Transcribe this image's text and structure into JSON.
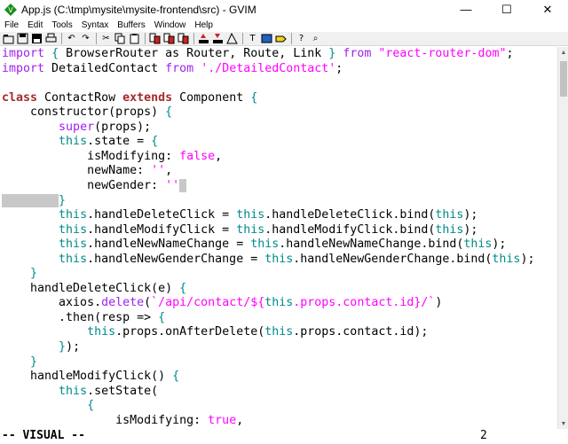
{
  "window": {
    "title": "App.js (C:\\tmp\\mysite\\mysite-frontend\\src) - GVIM",
    "minimize_glyph": "—",
    "maximize_glyph": "☐",
    "close_glyph": "✕"
  },
  "menu": {
    "items": [
      "File",
      "Edit",
      "Tools",
      "Syntax",
      "Buffers",
      "Window",
      "Help"
    ]
  },
  "toolbar": {
    "icons": [
      "open-icon",
      "save-icon",
      "save-all-icon",
      "print-icon",
      "undo-icon",
      "redo-icon",
      "cut-icon",
      "copy-icon",
      "paste-icon",
      "find-replace-icon",
      "find-next-icon",
      "find-prev-icon",
      "load-session-icon",
      "save-session-icon",
      "run-script-icon",
      "make-icon",
      "shell-icon",
      "tag-jump-icon",
      "help-icon",
      "find-help-icon"
    ]
  },
  "editor": {
    "lines": [
      [
        [
          "kw-import",
          "import"
        ],
        [
          "normal",
          " "
        ],
        [
          "paren",
          "{"
        ],
        [
          "normal",
          " BrowserRouter as Router, Route, Link "
        ],
        [
          "paren",
          "}"
        ],
        [
          "normal",
          " "
        ],
        [
          "kw-import",
          "from"
        ],
        [
          "normal",
          " "
        ],
        [
          "str",
          "\"react-router-dom\""
        ],
        [
          "normal",
          ";"
        ]
      ],
      [
        [
          "kw-import",
          "import"
        ],
        [
          "normal",
          " DetailedContact "
        ],
        [
          "kw-import",
          "from"
        ],
        [
          "normal",
          " "
        ],
        [
          "str",
          "'./DetailedContact'"
        ],
        [
          "normal",
          ";"
        ]
      ],
      [
        [
          "normal",
          ""
        ]
      ],
      [
        [
          "kw-class",
          "class"
        ],
        [
          "normal",
          " ContactRow "
        ],
        [
          "kw-class",
          "extends"
        ],
        [
          "normal",
          " Component "
        ],
        [
          "paren",
          "{"
        ]
      ],
      [
        [
          "normal",
          "    constructor(props) "
        ],
        [
          "paren",
          "{"
        ]
      ],
      [
        [
          "normal",
          "        "
        ],
        [
          "kw-stmt",
          "super"
        ],
        [
          "normal",
          "(props);"
        ]
      ],
      [
        [
          "normal",
          "        "
        ],
        [
          "this",
          "this"
        ],
        [
          "normal",
          ".state = "
        ],
        [
          "paren",
          "{"
        ]
      ],
      [
        [
          "normal",
          "            isModifying: "
        ],
        [
          "bool",
          "false"
        ],
        [
          "normal",
          ","
        ]
      ],
      [
        [
          "normal",
          "            newName: "
        ],
        [
          "str",
          "''"
        ],
        [
          "normal",
          ","
        ]
      ],
      [
        [
          "normal",
          "            newGender: "
        ],
        [
          "str",
          "''"
        ],
        [
          "cursor",
          " "
        ]
      ],
      [
        [
          "sel",
          "        "
        ],
        [
          "paren",
          "}"
        ]
      ],
      [
        [
          "normal",
          "        "
        ],
        [
          "this",
          "this"
        ],
        [
          "normal",
          ".handleDeleteClick = "
        ],
        [
          "this",
          "this"
        ],
        [
          "normal",
          ".handleDeleteClick.bind("
        ],
        [
          "this",
          "this"
        ],
        [
          "normal",
          ");"
        ]
      ],
      [
        [
          "normal",
          "        "
        ],
        [
          "this",
          "this"
        ],
        [
          "normal",
          ".handleModifyClick = "
        ],
        [
          "this",
          "this"
        ],
        [
          "normal",
          ".handleModifyClick.bind("
        ],
        [
          "this",
          "this"
        ],
        [
          "normal",
          ");"
        ]
      ],
      [
        [
          "normal",
          "        "
        ],
        [
          "this",
          "this"
        ],
        [
          "normal",
          ".handleNewNameChange = "
        ],
        [
          "this",
          "this"
        ],
        [
          "normal",
          ".handleNewNameChange.bind("
        ],
        [
          "this",
          "this"
        ],
        [
          "normal",
          ");"
        ]
      ],
      [
        [
          "normal",
          "        "
        ],
        [
          "this",
          "this"
        ],
        [
          "normal",
          ".handleNewGenderChange = "
        ],
        [
          "this",
          "this"
        ],
        [
          "normal",
          ".handleNewGenderChange.bind("
        ],
        [
          "this",
          "this"
        ],
        [
          "normal",
          ");"
        ]
      ],
      [
        [
          "normal",
          "    "
        ],
        [
          "paren",
          "}"
        ]
      ],
      [
        [
          "normal",
          "    handleDeleteClick(e) "
        ],
        [
          "paren",
          "{"
        ]
      ],
      [
        [
          "normal",
          "        axios."
        ],
        [
          "kw-stmt",
          "delete"
        ],
        [
          "normal",
          "("
        ],
        [
          "str",
          "`/api/contact/${"
        ],
        [
          "this",
          "this"
        ],
        [
          "str",
          ".props.contact.id}/`"
        ],
        [
          "normal",
          ")"
        ]
      ],
      [
        [
          "normal",
          "        .then(resp => "
        ],
        [
          "paren",
          "{"
        ]
      ],
      [
        [
          "normal",
          "            "
        ],
        [
          "this",
          "this"
        ],
        [
          "normal",
          ".props.onAfterDelete("
        ],
        [
          "this",
          "this"
        ],
        [
          "normal",
          ".props.contact.id);"
        ]
      ],
      [
        [
          "normal",
          "        "
        ],
        [
          "paren",
          "}"
        ],
        [
          "normal",
          ");"
        ]
      ],
      [
        [
          "normal",
          "    "
        ],
        [
          "paren",
          "}"
        ]
      ],
      [
        [
          "normal",
          "    handleModifyClick() "
        ],
        [
          "paren",
          "{"
        ]
      ],
      [
        [
          "normal",
          "        "
        ],
        [
          "this",
          "this"
        ],
        [
          "normal",
          ".setState("
        ]
      ],
      [
        [
          "normal",
          "            "
        ],
        [
          "paren",
          "{"
        ]
      ],
      [
        [
          "normal",
          "                isModifying: "
        ],
        [
          "bool",
          "true"
        ],
        [
          "normal",
          ","
        ]
      ]
    ]
  },
  "status": {
    "mode": "-- VISUAL --",
    "selection_count": "2"
  }
}
